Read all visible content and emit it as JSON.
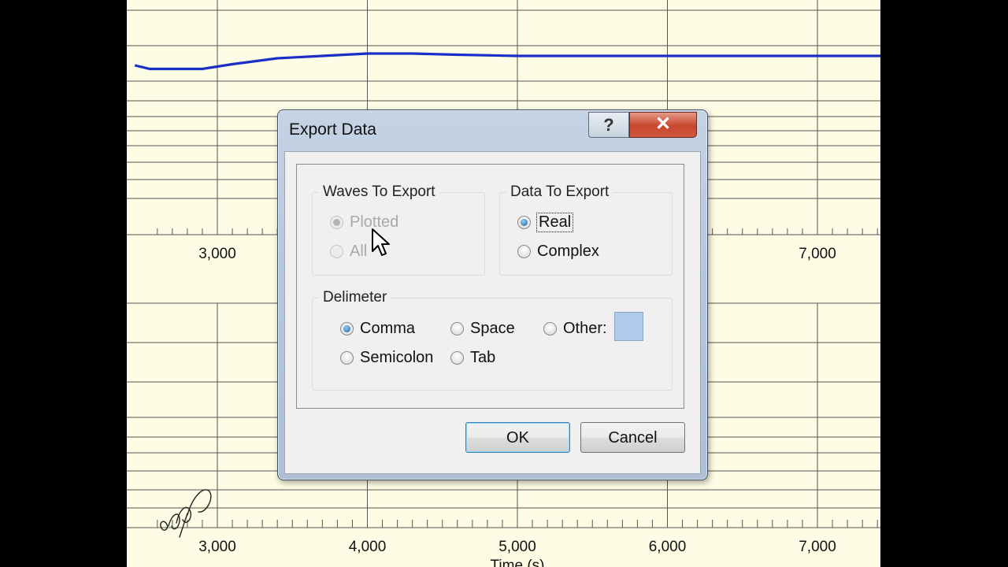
{
  "chart_data": {
    "type": "line",
    "series": [
      {
        "x": [
          2450,
          2550,
          2700,
          2900,
          3100,
          3400,
          3700,
          4000,
          4300,
          4600,
          5000,
          5500,
          6000,
          6500,
          7000,
          7500
        ],
        "y": [
          0.08,
          0.05,
          0.05,
          0.05,
          0.09,
          0.14,
          0.16,
          0.18,
          0.18,
          0.17,
          0.16,
          0.16,
          0.16,
          0.16,
          0.16,
          0.16
        ]
      }
    ],
    "x_ticks": [
      "3,000",
      "4,000",
      "5,000",
      "6,000",
      "7,000"
    ],
    "upper_x_ticks": [
      "3,000",
      "7,000"
    ],
    "xlabel": "Time (s)",
    "color": "#1a2fc8"
  },
  "dialog": {
    "title": "Export Data",
    "help_label": "?",
    "close_label": "✕",
    "waves_group": {
      "title": "Waves To Export",
      "options": [
        {
          "label": "Plotted",
          "checked": true,
          "disabled": true
        },
        {
          "label": "All",
          "checked": false,
          "disabled": true
        }
      ]
    },
    "data_group": {
      "title": "Data To Export",
      "options": [
        {
          "label": "Real",
          "checked": true
        },
        {
          "label": "Complex",
          "checked": false
        }
      ]
    },
    "delimeter_group": {
      "title": "Delimeter",
      "options": [
        {
          "label": "Comma",
          "checked": true
        },
        {
          "label": "Space",
          "checked": false
        },
        {
          "label": "Other:",
          "checked": false
        },
        {
          "label": "Semicolon",
          "checked": false
        },
        {
          "label": "Tab",
          "checked": false
        }
      ],
      "other_swatch_color": "#aecbea"
    },
    "ok_label": "OK",
    "cancel_label": "Cancel"
  }
}
